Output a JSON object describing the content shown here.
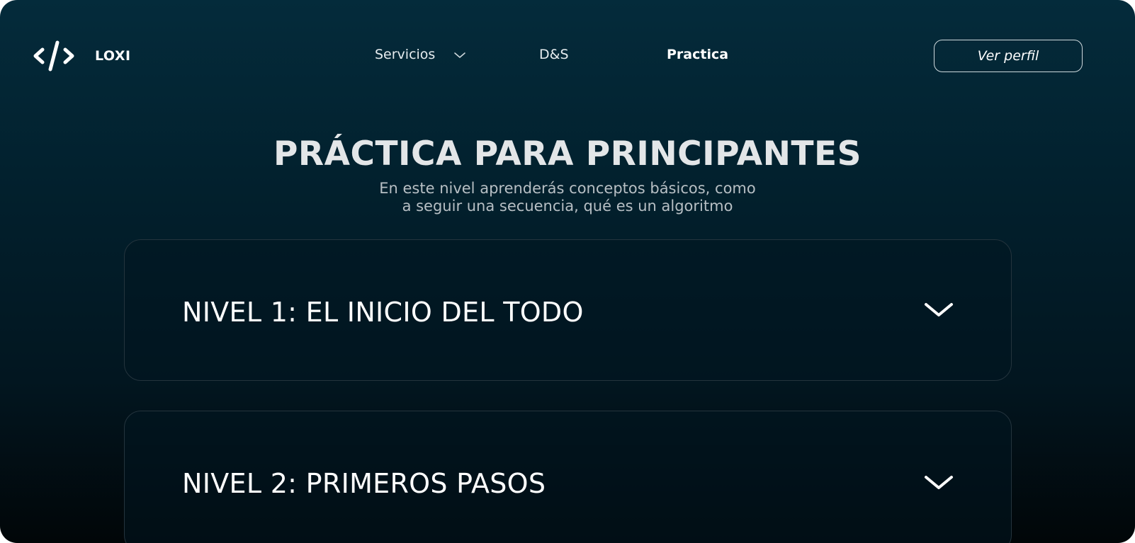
{
  "brand": {
    "name": "LOXI",
    "logo_icon": "code-brackets-icon"
  },
  "nav": {
    "items": [
      {
        "label": "Servicios",
        "has_dropdown": true
      },
      {
        "label": "D&S"
      },
      {
        "label": "Practica",
        "active": true
      }
    ],
    "profile_button": "Ver perfil"
  },
  "hero": {
    "title": "PRÁCTICA PARA PRINCIPANTES",
    "subtitle_line1": "En este nivel aprenderás conceptos básicos, como",
    "subtitle_line2": "a seguir una secuencia, qué es un algoritmo"
  },
  "levels": [
    {
      "title": "NIVEL 1: EL INICIO DEL TODO",
      "icon": "chevron-down-icon"
    },
    {
      "title": "NIVEL 2: PRIMEROS PASOS",
      "icon": "chevron-down-icon"
    }
  ],
  "colors": {
    "background_top": "#042b3b",
    "background_bottom": "#010608",
    "text": "#ffffff",
    "title_text": "#e3e6e8",
    "subtitle_text": "#b7bfc4"
  }
}
